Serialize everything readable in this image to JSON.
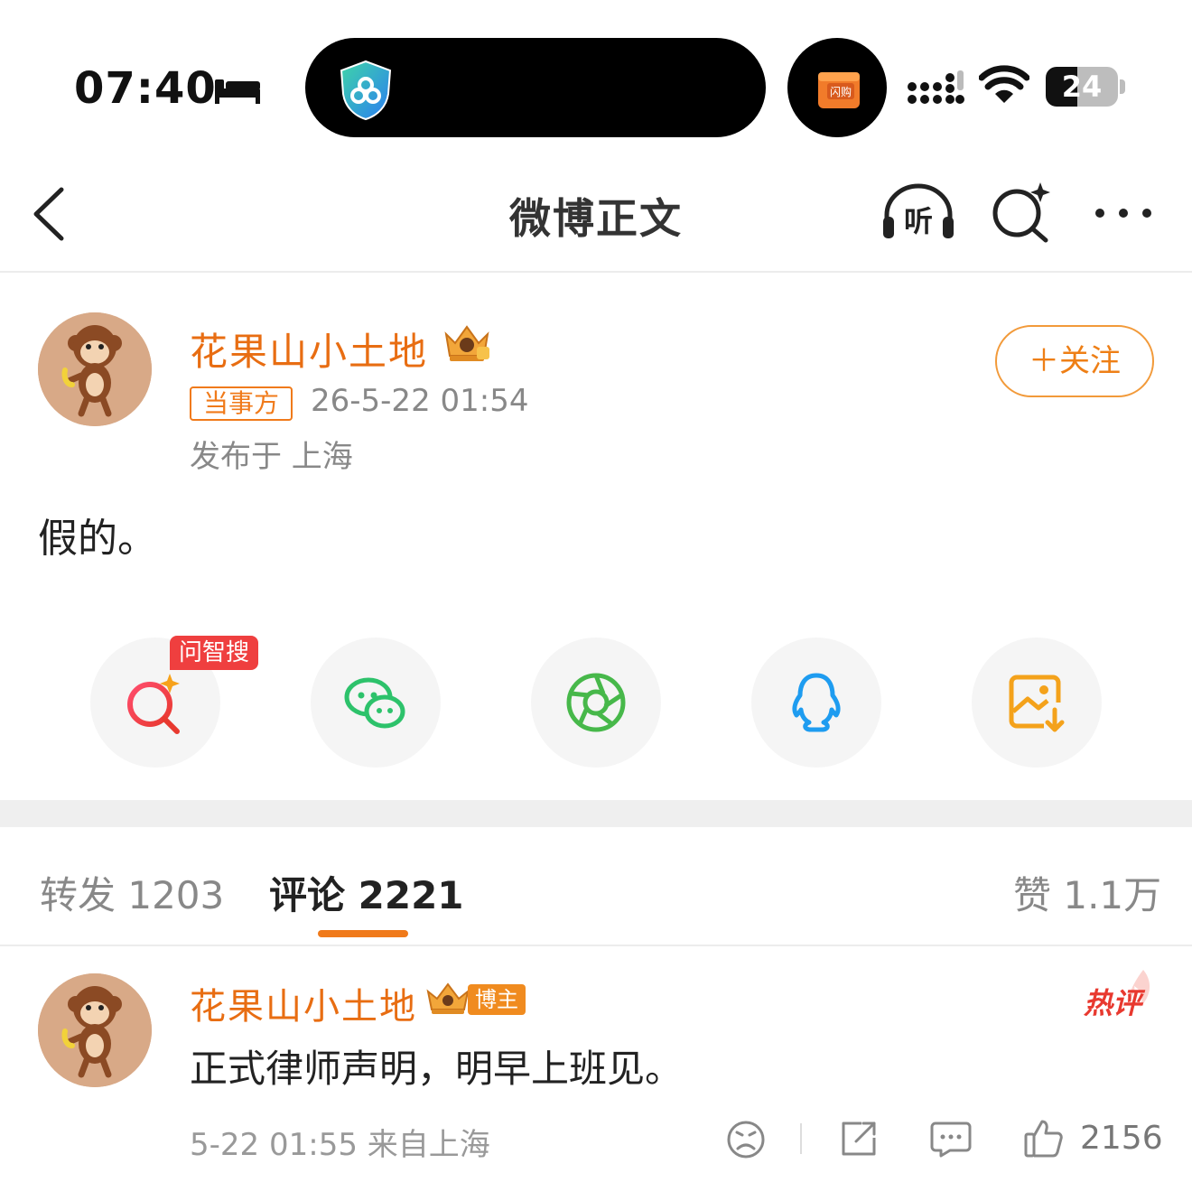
{
  "status_bar": {
    "time": "07:40",
    "battery": "24",
    "icons": [
      "bed-icon",
      "shield-icon",
      "shop-icon",
      "signal-icon",
      "wifi-icon",
      "battery-icon"
    ]
  },
  "nav": {
    "title": "微博正文",
    "listen_label": "听",
    "icons": [
      "back-icon",
      "listen-icon",
      "ai-search-icon",
      "more-icon"
    ]
  },
  "post": {
    "username": "花果山小土地",
    "badge": "当事方",
    "time": "26-5-22 01:54",
    "location": "发布于 上海",
    "follow_label": "＋关注",
    "text": "假的。"
  },
  "share": {
    "ask_badge": "问智搜",
    "items": [
      "ai-search-icon",
      "wechat-icon",
      "moments-icon",
      "qq-icon",
      "save-image-icon"
    ]
  },
  "tabs": {
    "repost": "转发 1203",
    "comment": "评论 2221",
    "like": "赞 1.1万"
  },
  "comment": {
    "username": "花果山小土地",
    "blogger_badge": "博主",
    "hot_badge": "热评",
    "text": "正式律师声明，明早上班见。",
    "meta": "5-22 01:55 来自上海",
    "like_count": "2156"
  },
  "colors": {
    "accent": "#f07a1a",
    "username": "#e86d12",
    "hot": "#e8392f",
    "ask_badge": "#ef3f3f"
  }
}
